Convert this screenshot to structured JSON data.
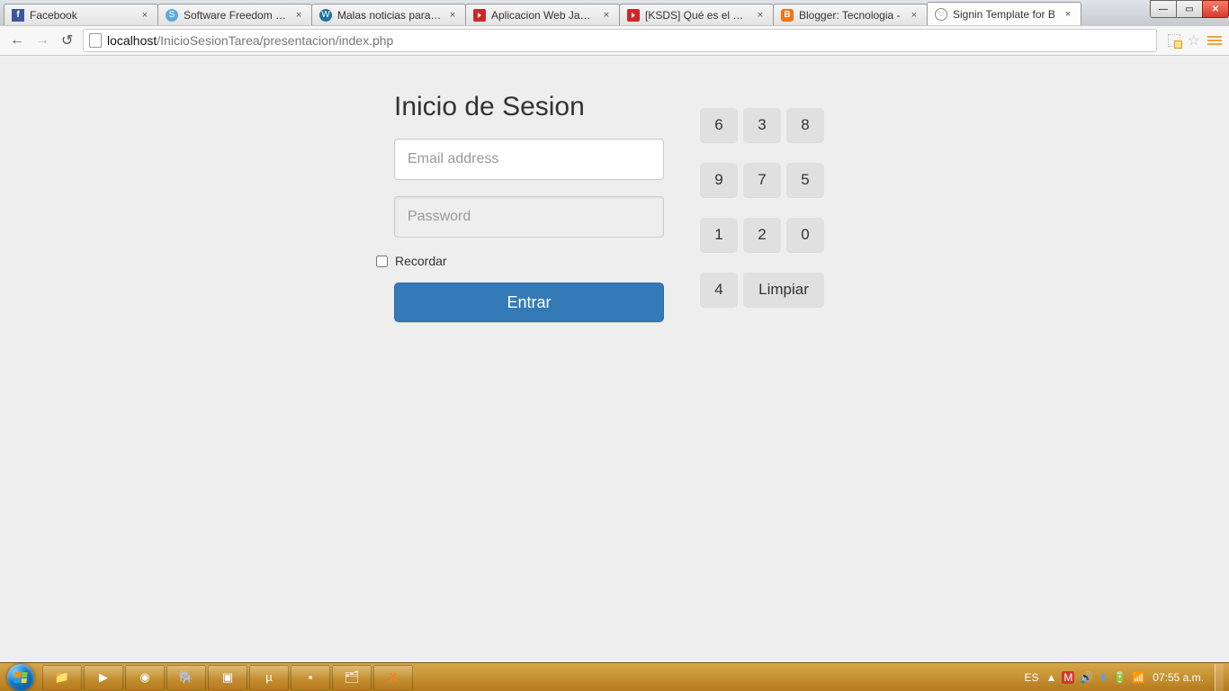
{
  "browser": {
    "tabs": [
      {
        "title": "Facebook",
        "favicon": "fb"
      },
      {
        "title": "Software Freedom Day",
        "favicon": "sfd"
      },
      {
        "title": "Malas noticias para So",
        "favicon": "wp"
      },
      {
        "title": "Aplicacion Web Java M",
        "favicon": "yt"
      },
      {
        "title": "[KSDS] Qué es el Mod",
        "favicon": "yt"
      },
      {
        "title": "Blogger: Tecnologia -",
        "favicon": "bl"
      },
      {
        "title": "Signin Template for B",
        "favicon": "doc",
        "active": true
      }
    ],
    "url_host": "localhost",
    "url_path": "/InicioSesionTarea/presentacion/index.php"
  },
  "page": {
    "title": "Inicio de Sesion",
    "email_placeholder": "Email address",
    "password_placeholder": "Password",
    "remember_label": "Recordar",
    "submit_label": "Entrar",
    "keypad": {
      "keys": [
        "6",
        "3",
        "8",
        "9",
        "7",
        "5",
        "1",
        "2",
        "0",
        "4"
      ],
      "clear_label": "Limpiar"
    }
  },
  "taskbar": {
    "lang": "ES",
    "clock": "07:55 a.m."
  }
}
